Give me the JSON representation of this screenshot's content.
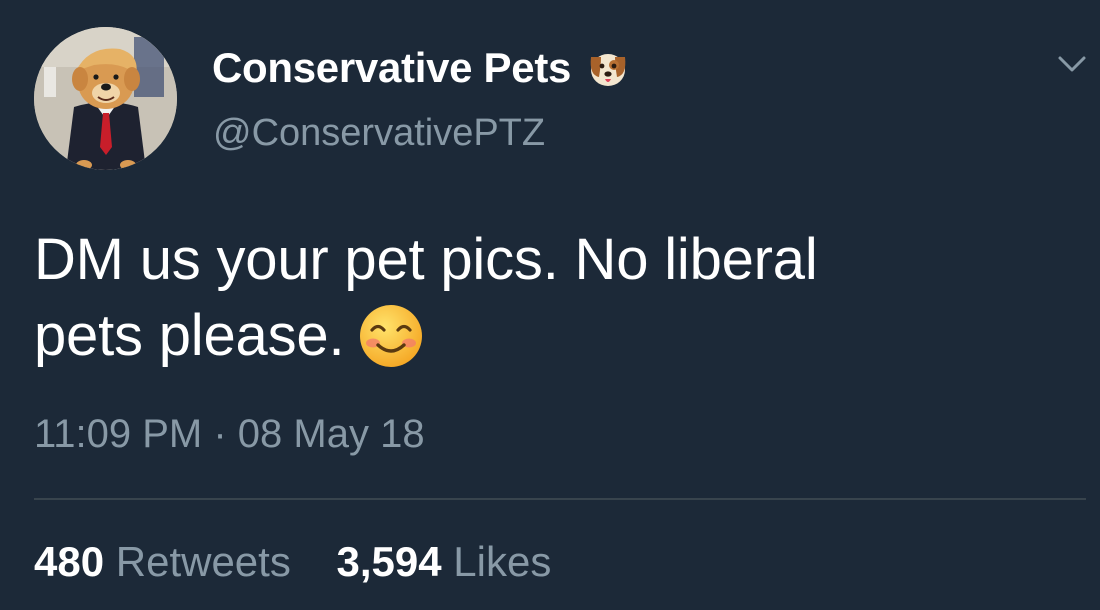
{
  "author": {
    "display_name": "Conservative Pets",
    "handle": "@ConservativePTZ",
    "name_emoji": "dog-face-icon"
  },
  "tweet": {
    "text_line_1": "DM us your pet pics. No liberal",
    "text_line_2": "pets please.",
    "trailing_emoji": "smiling-face-icon",
    "timestamp": "11:09 PM · 08 May 18"
  },
  "stats": {
    "retweets_count": "480",
    "retweets_label": "Retweets",
    "likes_count": "3,594",
    "likes_label": "Likes"
  },
  "colors": {
    "background": "#1c2938",
    "secondary_text": "#8899a6",
    "divider": "#38444d"
  }
}
